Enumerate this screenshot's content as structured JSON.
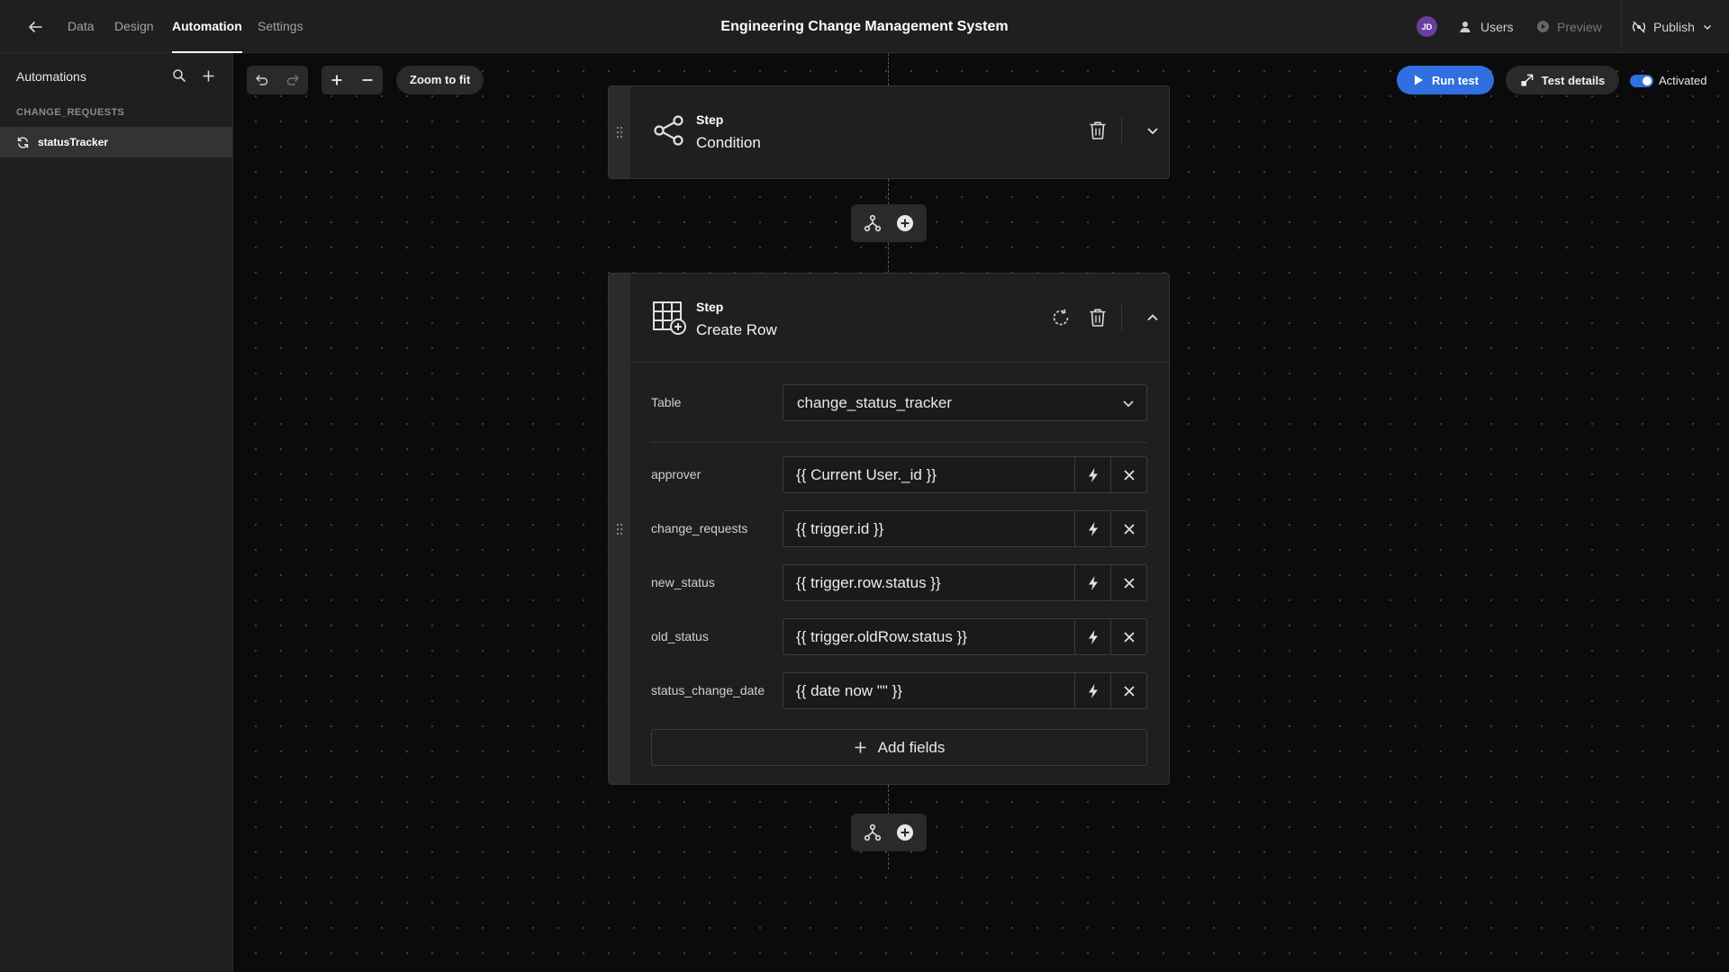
{
  "nav": {
    "tabs": [
      "Data",
      "Design",
      "Automation",
      "Settings"
    ],
    "active_tab": "Automation",
    "title": "Engineering Change Management System",
    "avatar_initials": "JD",
    "users_label": "Users",
    "preview_label": "Preview",
    "publish_label": "Publish"
  },
  "sidebar": {
    "title": "Automations",
    "section": "CHANGE_REQUESTS",
    "items": [
      {
        "label": "statusTracker",
        "icon": "refresh-icon"
      }
    ]
  },
  "toolbar": {
    "zoom_fit_label": "Zoom to fit",
    "run_test_label": "Run test",
    "test_details_label": "Test details",
    "activated_label": "Activated",
    "activated": true
  },
  "steps": [
    {
      "kicker": "Step",
      "name": "Condition",
      "icon": "branch-share-icon",
      "expanded": false
    },
    {
      "kicker": "Step",
      "name": "Create Row",
      "icon": "table-add-icon",
      "expanded": true,
      "table_label": "Table",
      "table_value": "change_status_tracker",
      "fields": [
        {
          "name": "approver",
          "value": "{{ Current User._id }}"
        },
        {
          "name": "change_requests",
          "value": "{{ trigger.id }}"
        },
        {
          "name": "new_status",
          "value": "{{ trigger.row.status }}"
        },
        {
          "name": "old_status",
          "value": "{{ trigger.oldRow.status }}"
        },
        {
          "name": "status_change_date",
          "value": "{{ date now \"\" }}"
        }
      ],
      "add_fields_label": "Add fields"
    }
  ],
  "colors": {
    "accent": "#2f6fe0",
    "avatar": "#6b3fa0",
    "background": "#0b0b0b",
    "panel": "#1f1f1f"
  }
}
